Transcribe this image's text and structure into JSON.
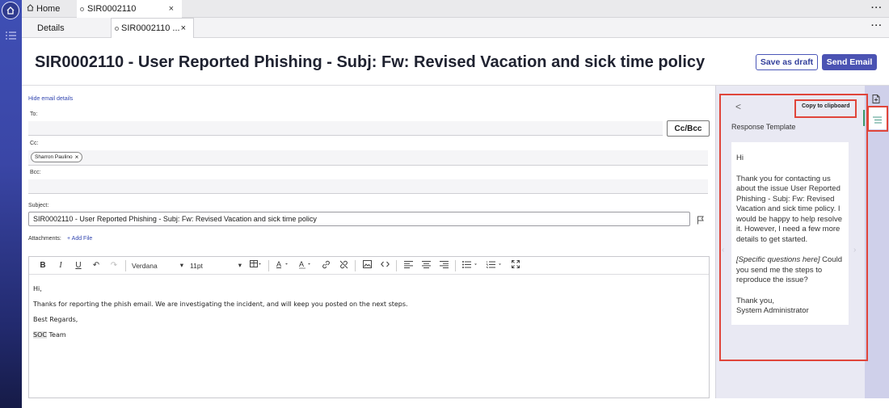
{
  "top_tabs": {
    "home_label": "Home",
    "record_label": "SIR0002110",
    "close_glyph": "×",
    "more_glyph": "···"
  },
  "sub_tabs": {
    "details_label": "Details",
    "record_label": "SIR0002110 ...",
    "close_glyph": "×",
    "more_glyph": "···"
  },
  "header": {
    "title": "SIR0002110 - User Reported Phishing - Subj: Fw: Revised Vacation and sick time policy",
    "save_draft_label": "Save as draft",
    "send_label": "Send Email"
  },
  "email": {
    "hide_details_label": "Hide email details",
    "to_label": "To:",
    "to_value": "",
    "cc_bcc_button": "Cc/Bcc",
    "cc_label": "Cc:",
    "cc_recipients": [
      {
        "name": "Sharron Paulino",
        "remove": "×"
      }
    ],
    "bcc_label": "Bcc:",
    "subject_label": "Subject:",
    "subject_value": "SIR0002110 - User Reported Phishing - Subj: Fw: Revised Vacation and sick time policy",
    "attachments_label": "Attachments:",
    "add_file_label": "+ Add File"
  },
  "editor": {
    "toolbar": {
      "bold": "B",
      "italic": "I",
      "underline": "U",
      "undo": "↶",
      "redo": "↷",
      "font_family": "Verdana",
      "font_size": "11pt",
      "dropdown_glyph": "▾"
    },
    "body": {
      "line1": "Hi,",
      "line2": "Thanks for reporting the phish email. We are investigating the incident, and will keep you posted on the next steps.",
      "line3": "Best Regards,",
      "line4_highlight": "SOC",
      "line4_rest": " Team"
    }
  },
  "response_panel": {
    "back_glyph": "<",
    "copy_label": "Copy to clipboard",
    "title": "Response Template",
    "greeting": "Hi",
    "paragraph1": "Thank you for contacting us about the issue User Reported Phishing - Subj: Fw: Revised Vacation and sick time policy. I would be happy to help resolve it. However, I need a few more details to get started.",
    "questions_italic": "[Specific questions here]",
    "questions_rest": " Could you send me the steps to reproduce the issue?",
    "closing": "Thank you,",
    "signature": "System Administrator",
    "prev_glyph": "‹",
    "next_glyph": "›"
  },
  "colors": {
    "accent": "#4b53b3",
    "highlight_box": "#e0453a",
    "rail": "#3f4fb5"
  }
}
